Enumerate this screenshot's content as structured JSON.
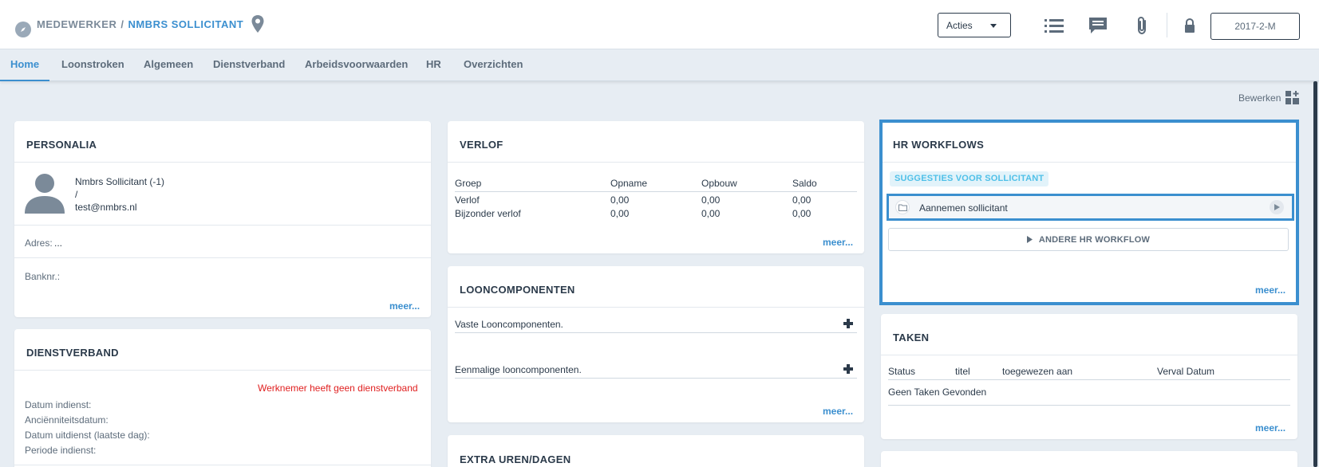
{
  "header": {
    "breadcrumb_part1": "MEDEWERKER",
    "breadcrumb_sep": "/",
    "breadcrumb_part2": "NMBRS SOLLICITANT",
    "acties_label": "Acties",
    "period_label": "2017-2-M"
  },
  "nav": {
    "tabs": [
      "Home",
      "Loonstroken",
      "Algemeen",
      "Dienstverband",
      "Arbeidsvoorwaarden",
      "HR",
      "Overzichten"
    ],
    "active": "Home"
  },
  "bewerken_label": "Bewerken",
  "personalia": {
    "title": "PERSONALIA",
    "name": "Nmbrs Sollicitant (-1)",
    "slash": "/",
    "email": "test@nmbrs.nl",
    "adres_label": "Adres:",
    "adres_value": "...",
    "banknr_label": "Banknr.:",
    "meer": "meer..."
  },
  "dienstverband": {
    "title": "DIENSTVERBAND",
    "warning": "Werknemer heeft geen dienstverband",
    "fields": [
      "Datum indienst:",
      "Anciënniteitsdatum:",
      "Datum uitdienst (laatste dag):",
      "Periode indienst:"
    ]
  },
  "verlof": {
    "title": "VERLOF",
    "columns": [
      "Groep",
      "Opname",
      "Opbouw",
      "Saldo"
    ],
    "rows": [
      [
        "Verlof",
        "0,00",
        "0,00",
        "0,00"
      ],
      [
        "Bijzonder verlof",
        "0,00",
        "0,00",
        "0,00"
      ]
    ],
    "meer": "meer..."
  },
  "looncomponenten": {
    "title": "LOONCOMPONENTEN",
    "vaste": "Vaste Looncomponenten.",
    "eenmalige": "Eenmalige looncomponenten.",
    "meer": "meer..."
  },
  "extra": {
    "title": "EXTRA UREN/DAGEN"
  },
  "hr_workflows": {
    "title": "HR WORKFLOWS",
    "suggesties": "SUGGESTIES VOOR SOLLICITANT",
    "item": "Aannemen sollicitant",
    "andere": "ANDERE HR WORKFLOW",
    "meer": "meer..."
  },
  "taken": {
    "title": "TAKEN",
    "columns": [
      "Status",
      "titel",
      "toegewezen aan",
      "Verval Datum"
    ],
    "empty": "Geen Taken Gevonden",
    "meer": "meer..."
  },
  "colors": {
    "accent": "#3b8fcf",
    "warning": "#e02020",
    "suggestion": "#4fc0e8"
  }
}
